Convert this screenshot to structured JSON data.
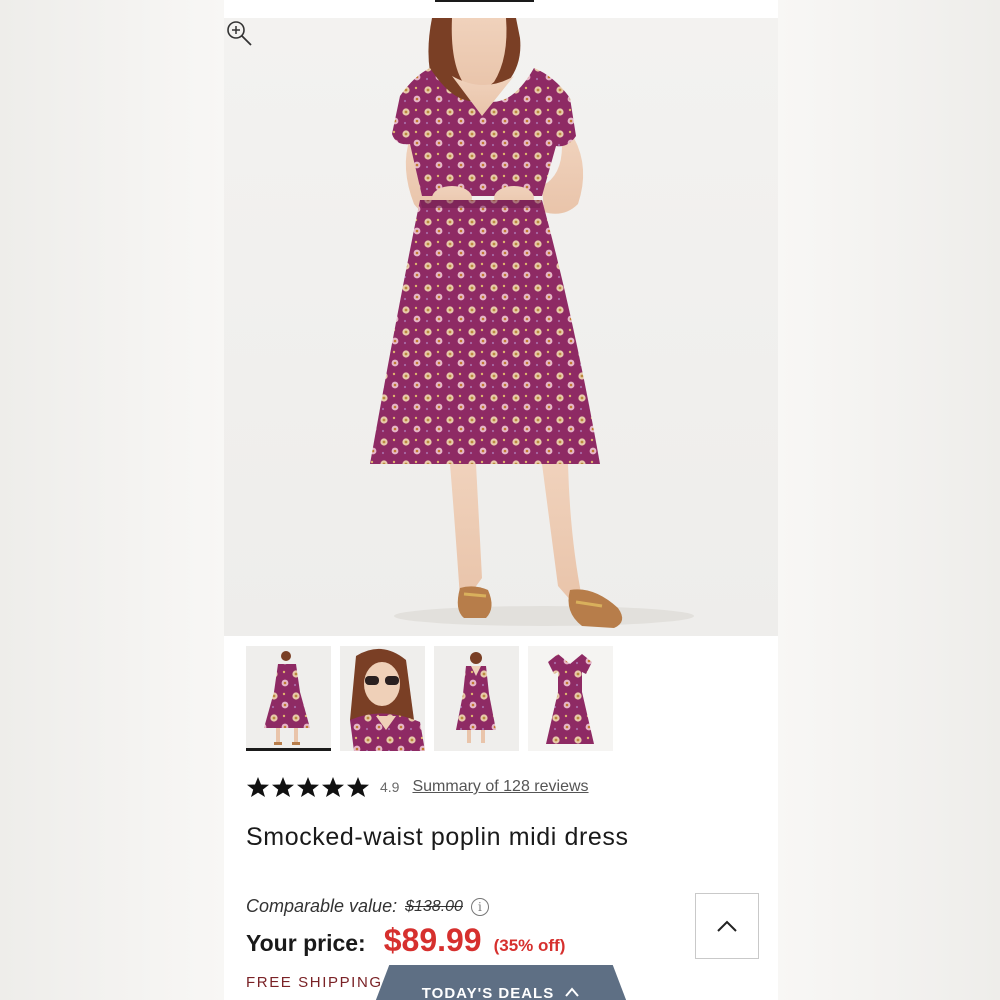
{
  "product": {
    "title": "Smocked-waist poplin midi dress",
    "rating": "4.9",
    "stars": 5,
    "reviews_link": "Summary of 128 reviews"
  },
  "pricing": {
    "comparable_label": "Comparable value:",
    "comparable_value": "$138.00",
    "your_price_label": "Your price:",
    "price": "$89.99",
    "discount": "(35% off)"
  },
  "shipping": {
    "label": "FREE SHIPPING"
  },
  "deals_tab": {
    "label": "TODAY'S DEALS"
  },
  "gallery": {
    "thumbnails": [
      "full-front-view",
      "closeup-sunglasses-view",
      "back-view",
      "flat-lay-view"
    ],
    "active_index": 0
  },
  "icons": {
    "zoom": "zoom-in-icon",
    "info": "info-icon",
    "scroll_top": "chevron-up-icon",
    "deals": "chevron-up-icon",
    "star": "star-icon"
  },
  "colors": {
    "price_red": "#d6302e",
    "shipping_red": "#7a2226",
    "deals_slate": "#5e6f84",
    "dress_plum": "#8e2a64"
  }
}
